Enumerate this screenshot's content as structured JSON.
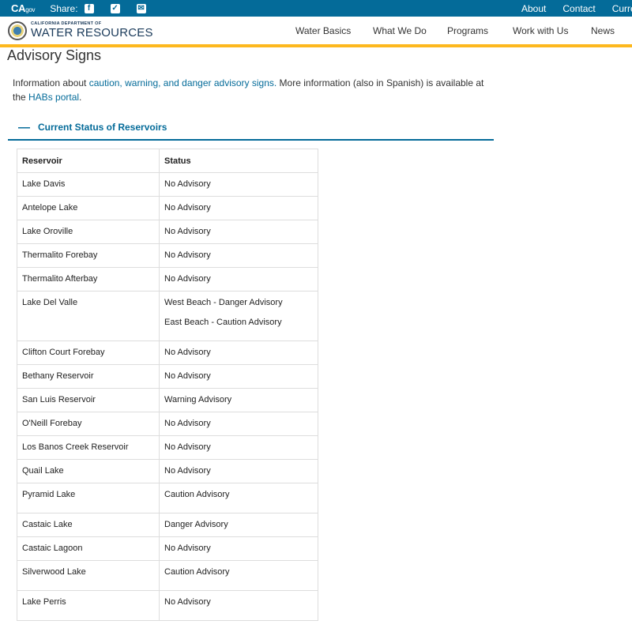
{
  "utility": {
    "ca_logo": "CA",
    "ca_gov": "gov",
    "share": "Share:",
    "links": [
      "About",
      "Contact",
      "Curren"
    ]
  },
  "social": [
    "facebook-icon",
    "twitter-icon",
    "email-icon"
  ],
  "header": {
    "logo_small": "CALIFORNIA DEPARTMENT OF",
    "logo_big": "WATER RESOURCES",
    "nav": [
      "Water Basics",
      "What We Do",
      "Programs",
      "Work with Us",
      "News"
    ]
  },
  "page": {
    "title": "Advisory Signs",
    "intro_before": "Information about ",
    "intro_link1": "caution, warning, and danger advisory signs.",
    "intro_middle": " More information (also in Spanish) is available at the ",
    "intro_link2": "HABs portal",
    "intro_after": "."
  },
  "accordion": {
    "toggle": "—",
    "title": "Current Status of Reservoirs"
  },
  "table": {
    "headers": [
      "Reservoir",
      "Status"
    ],
    "rows": [
      {
        "reservoir": " Lake Davis",
        "status": "No Advisory"
      },
      {
        "reservoir": " Antelope Lake",
        "status": "No Advisory"
      },
      {
        "reservoir": "Lake Oroville",
        "status": "No Advisory"
      },
      {
        "reservoir": "Thermalito Forebay",
        "status": "No Advisory"
      },
      {
        "reservoir": "Thermalito Afterbay",
        "status": "No Advisory"
      },
      {
        "reservoir": "Lake Del Valle",
        "status": "West Beach - Danger Advisory",
        "status2": "East Beach - Caution Advisory"
      },
      {
        "reservoir": "Clifton Court Forebay",
        "status": "No Advisory"
      },
      {
        "reservoir": "Bethany Reservoir",
        "status": "No Advisory"
      },
      {
        "reservoir": "San Luis Reservoir",
        "status": "Warning Advisory"
      },
      {
        "reservoir": "O'Neill Forebay",
        "status": "No Advisory"
      },
      {
        "reservoir": "Los Banos Creek Reservoir",
        "status": "No Advisory"
      },
      {
        "reservoir": "Quail Lake",
        "status": "No Advisory"
      },
      {
        "reservoir": "Pyramid Lake",
        "status": "Caution Advisory"
      },
      {
        "reservoir": "Castaic Lake",
        "status": "Danger Advisory"
      },
      {
        "reservoir": "Castaic Lagoon",
        "status": "No Advisory"
      },
      {
        "reservoir": "Silverwood Lake",
        "status": "Caution Advisory"
      },
      {
        "reservoir": "Lake Perris",
        "status": "No Advisory"
      }
    ]
  },
  "colors": {
    "utility_bar": "#046b99",
    "accent": "#fdb81e",
    "link": "#046b99"
  }
}
